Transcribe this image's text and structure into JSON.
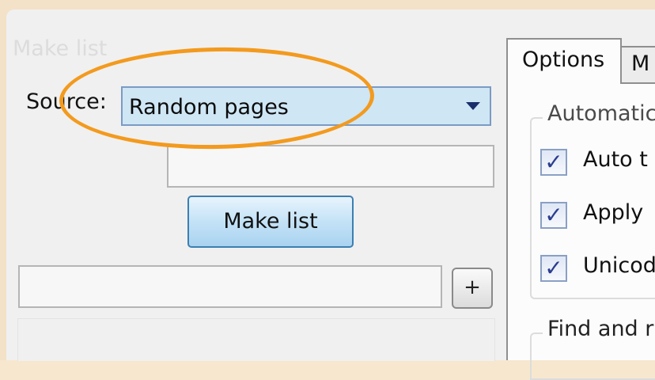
{
  "group": {
    "title": "Make list"
  },
  "source": {
    "label": "Source:",
    "selected": "Random pages"
  },
  "make_list_button": {
    "label": "Make list"
  },
  "add_button": {
    "label": "+"
  },
  "tabs": [
    {
      "label": "Options",
      "active": true
    },
    {
      "label": "M",
      "active": false
    }
  ],
  "options": {
    "automatic_group": "Automatic",
    "checkboxes": [
      {
        "label": "Auto t",
        "checked": true
      },
      {
        "label": "Apply",
        "checked": true
      },
      {
        "label": "Unicod",
        "checked": true
      }
    ],
    "find_group": "Find and r"
  },
  "check_glyph": "✓",
  "colors": {
    "highlight": "#f39a1e",
    "combo_bg": "#cfe6f5",
    "button_border": "#3c7fb1"
  }
}
